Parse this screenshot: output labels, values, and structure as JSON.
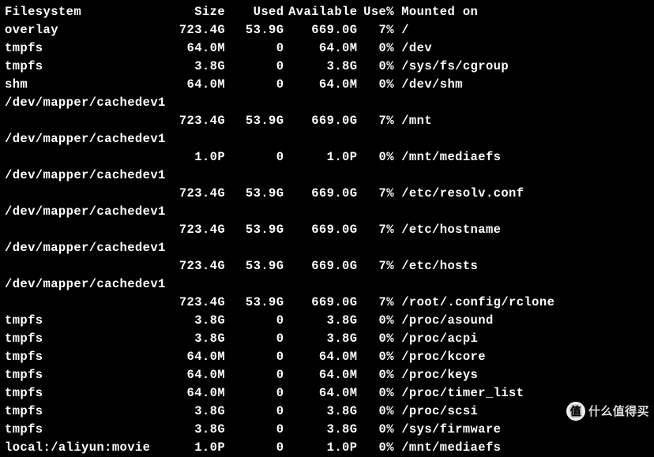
{
  "header": {
    "filesystem": "Filesystem",
    "size": "Size",
    "used": "Used",
    "avail": "Available",
    "usep": "Use%",
    "mounted": "Mounted on"
  },
  "rows": [
    {
      "fs": "overlay",
      "size": "723.4G",
      "used": "53.9G",
      "avail": "669.0G",
      "usep": "7%",
      "mount": "/"
    },
    {
      "fs": "tmpfs",
      "size": "64.0M",
      "used": "0",
      "avail": "64.0M",
      "usep": "0%",
      "mount": "/dev"
    },
    {
      "fs": "tmpfs",
      "size": "3.8G",
      "used": "0",
      "avail": "3.8G",
      "usep": "0%",
      "mount": "/sys/fs/cgroup"
    },
    {
      "fs": "shm",
      "size": "64.0M",
      "used": "0",
      "avail": "64.0M",
      "usep": "0%",
      "mount": "/dev/shm"
    },
    {
      "fs": "/dev/mapper/cachedev1",
      "size": "",
      "used": "",
      "avail": "",
      "usep": "",
      "mount": ""
    },
    {
      "fs": "",
      "size": "723.4G",
      "used": "53.9G",
      "avail": "669.0G",
      "usep": "7%",
      "mount": "/mnt"
    },
    {
      "fs": "/dev/mapper/cachedev1",
      "size": "",
      "used": "",
      "avail": "",
      "usep": "",
      "mount": ""
    },
    {
      "fs": "",
      "size": "1.0P",
      "used": "0",
      "avail": "1.0P",
      "usep": "0%",
      "mount": "/mnt/mediaefs"
    },
    {
      "fs": "/dev/mapper/cachedev1",
      "size": "",
      "used": "",
      "avail": "",
      "usep": "",
      "mount": ""
    },
    {
      "fs": "",
      "size": "723.4G",
      "used": "53.9G",
      "avail": "669.0G",
      "usep": "7%",
      "mount": "/etc/resolv.conf"
    },
    {
      "fs": "/dev/mapper/cachedev1",
      "size": "",
      "used": "",
      "avail": "",
      "usep": "",
      "mount": ""
    },
    {
      "fs": "",
      "size": "723.4G",
      "used": "53.9G",
      "avail": "669.0G",
      "usep": "7%",
      "mount": "/etc/hostname"
    },
    {
      "fs": "/dev/mapper/cachedev1",
      "size": "",
      "used": "",
      "avail": "",
      "usep": "",
      "mount": ""
    },
    {
      "fs": "",
      "size": "723.4G",
      "used": "53.9G",
      "avail": "669.0G",
      "usep": "7%",
      "mount": "/etc/hosts"
    },
    {
      "fs": "/dev/mapper/cachedev1",
      "size": "",
      "used": "",
      "avail": "",
      "usep": "",
      "mount": ""
    },
    {
      "fs": "",
      "size": "723.4G",
      "used": "53.9G",
      "avail": "669.0G",
      "usep": "7%",
      "mount": "/root/.config/rclone"
    },
    {
      "fs": "tmpfs",
      "size": "3.8G",
      "used": "0",
      "avail": "3.8G",
      "usep": "0%",
      "mount": "/proc/asound"
    },
    {
      "fs": "tmpfs",
      "size": "3.8G",
      "used": "0",
      "avail": "3.8G",
      "usep": "0%",
      "mount": "/proc/acpi"
    },
    {
      "fs": "tmpfs",
      "size": "64.0M",
      "used": "0",
      "avail": "64.0M",
      "usep": "0%",
      "mount": "/proc/kcore"
    },
    {
      "fs": "tmpfs",
      "size": "64.0M",
      "used": "0",
      "avail": "64.0M",
      "usep": "0%",
      "mount": "/proc/keys"
    },
    {
      "fs": "tmpfs",
      "size": "64.0M",
      "used": "0",
      "avail": "64.0M",
      "usep": "0%",
      "mount": "/proc/timer_list"
    },
    {
      "fs": "tmpfs",
      "size": "3.8G",
      "used": "0",
      "avail": "3.8G",
      "usep": "0%",
      "mount": "/proc/scsi"
    },
    {
      "fs": "tmpfs",
      "size": "3.8G",
      "used": "0",
      "avail": "3.8G",
      "usep": "0%",
      "mount": "/sys/firmware"
    },
    {
      "fs": "local:/aliyun:movie",
      "size": "1.0P",
      "used": "0",
      "avail": "1.0P",
      "usep": "0%",
      "mount": "/mnt/mediaefs"
    }
  ],
  "watermark": {
    "badge": "值",
    "text": "什么值得买"
  }
}
